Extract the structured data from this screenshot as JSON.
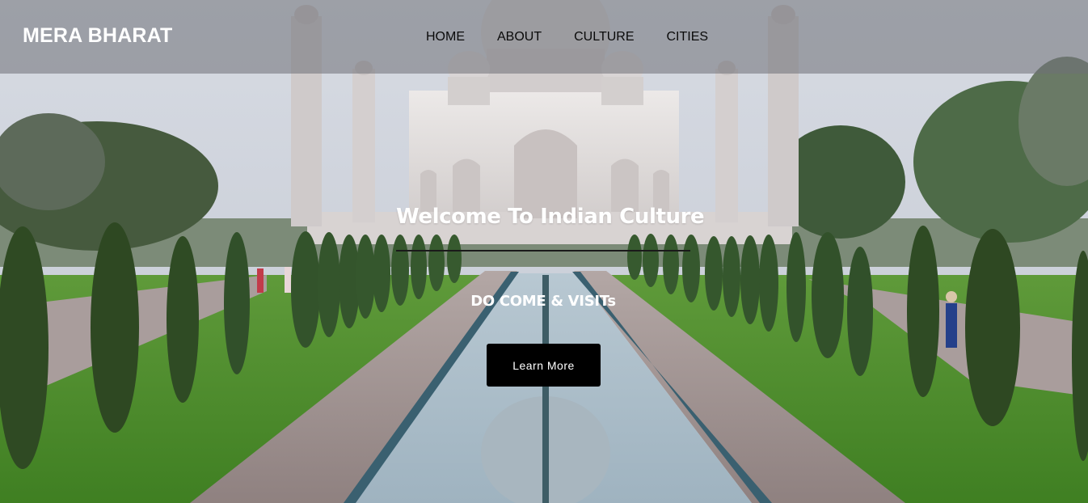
{
  "header": {
    "brand": "MERA BHARAT",
    "nav": [
      {
        "label": "HOME"
      },
      {
        "label": "ABOUT"
      },
      {
        "label": "CULTURE"
      },
      {
        "label": "CITIES"
      }
    ]
  },
  "hero": {
    "title": "Welcome To Indian Culture",
    "subtitle": "DO COME & VISITs",
    "cta_label": "Learn More",
    "background": "taj-mahal-photo"
  },
  "colors": {
    "nav_overlay": "#6e7076",
    "nav_text": "#0a0a0a",
    "brand_text": "#ffffff",
    "cta_bg": "#000000",
    "cta_text": "#ffffff"
  }
}
